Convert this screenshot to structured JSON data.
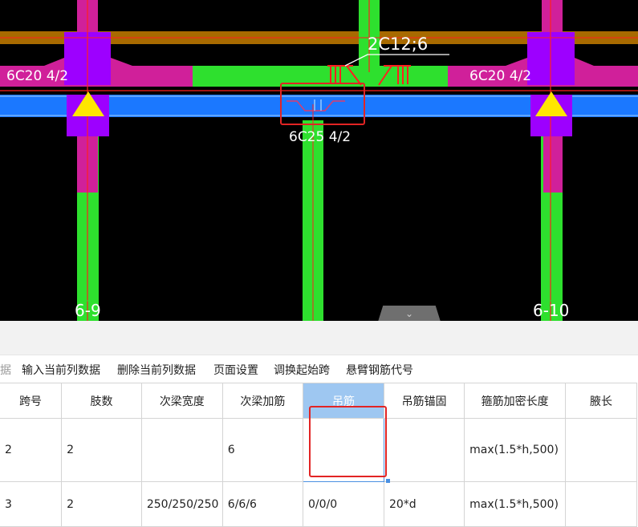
{
  "cad": {
    "labels": {
      "left_top_rebar": "6C20 4/2",
      "right_top_rebar": "6C20 4/2",
      "center_bottom_rebar": "6C25 4/2",
      "hanger_rebar": "2C12;6",
      "axis_left": "6-9",
      "axis_right": "6-10"
    },
    "colors": {
      "background": "#000000",
      "column": "#9d00ff",
      "beam_brown": "#a86a00",
      "beam_green": "#2ee02e",
      "beam_magenta": "#d0209a",
      "beam_blue": "#1b78ff",
      "rebar_red": "#ff2020",
      "support_marker": "#ffe600"
    },
    "collapse_icon": "chevron-down-icon"
  },
  "toolbar": {
    "cut_text": "据",
    "items": [
      "输入当前列数据",
      "删除当前列数据",
      "页面设置",
      "调换起始跨",
      "悬臂钢筋代号"
    ]
  },
  "grid": {
    "headers": [
      "跨号",
      "肢数",
      "次梁宽度",
      "次梁加筋",
      "吊筋",
      "吊筋锚固",
      "箍筋加密长度",
      "腋长"
    ],
    "rows": [
      [
        "2",
        "2",
        "",
        "6",
        "",
        "",
        "max(1.5*h,500)",
        ""
      ],
      [
        "3",
        "2",
        "250/250/250",
        "6/6/6",
        "0/0/0",
        "20*d",
        "max(1.5*h,500)",
        ""
      ]
    ],
    "selected_column": "吊筋"
  }
}
